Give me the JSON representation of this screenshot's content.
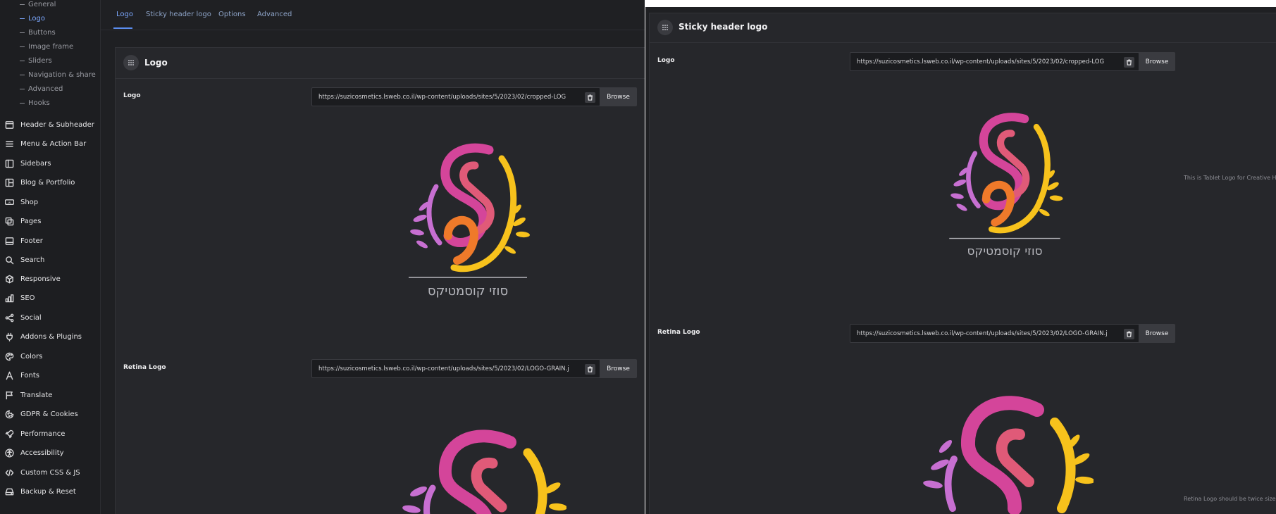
{
  "sidebar": {
    "sub_items": [
      "General",
      "Logo",
      "Buttons",
      "Image frame",
      "Sliders",
      "Navigation & share",
      "Advanced",
      "Hooks"
    ],
    "active_sub_item": "Logo",
    "items": [
      {
        "label": "Header & Subheader",
        "icon": "header-icon"
      },
      {
        "label": "Menu & Action Bar",
        "icon": "menu-icon"
      },
      {
        "label": "Sidebars",
        "icon": "sidebar-icon"
      },
      {
        "label": "Blog & Portfolio",
        "icon": "blog-icon"
      },
      {
        "label": "Shop",
        "icon": "woo-icon"
      },
      {
        "label": "Pages",
        "icon": "pages-icon"
      },
      {
        "label": "Footer",
        "icon": "footer-icon"
      },
      {
        "label": "Search",
        "icon": "search-icon"
      },
      {
        "label": "Responsive",
        "icon": "responsive-icon"
      },
      {
        "label": "SEO",
        "icon": "seo-icon"
      },
      {
        "label": "Social",
        "icon": "share-icon"
      },
      {
        "label": "Addons & Plugins",
        "icon": "plug-icon"
      },
      {
        "label": "Colors",
        "icon": "palette-icon"
      },
      {
        "label": "Fonts",
        "icon": "font-icon"
      },
      {
        "label": "Translate",
        "icon": "flag-icon"
      },
      {
        "label": "GDPR & Cookies",
        "icon": "cookie-icon"
      },
      {
        "label": "Performance",
        "icon": "rocket-icon"
      },
      {
        "label": "Accessibility",
        "icon": "accessibility-icon"
      },
      {
        "label": "Custom CSS & JS",
        "icon": "code-icon"
      },
      {
        "label": "Backup & Reset",
        "icon": "drive-icon"
      }
    ]
  },
  "tabs": {
    "items": [
      "Logo",
      "Sticky header logo",
      "Options",
      "Advanced"
    ],
    "active": "Logo"
  },
  "left_panel": {
    "title": "Logo",
    "logo_field": {
      "label": "Logo",
      "value": "https://suzicosmetics.lsweb.co.il/wp-content/uploads/sites/5/2023/02/cropped-LOG",
      "browse_label": "Browse"
    },
    "retina_field": {
      "label": "Retina Logo",
      "value": "https://suzicosmetics.lsweb.co.il/wp-content/uploads/sites/5/2023/02/LOGO-GRAIN.j",
      "browse_label": "Browse"
    },
    "logo_caption": "סוזי קוסמטיקס"
  },
  "right_panel": {
    "title": "Sticky header logo",
    "logo_field": {
      "label": "Logo",
      "value": "https://suzicosmetics.lsweb.co.il/wp-content/uploads/sites/5/2023/02/cropped-LOG",
      "browse_label": "Browse",
      "note": "This is Tablet Logo for Creative H"
    },
    "retina_field": {
      "label": "Retina Logo",
      "value": "https://suzicosmetics.lsweb.co.il/wp-content/uploads/sites/5/2023/02/LOGO-GRAIN.j",
      "browse_label": "Browse",
      "note": "Retina Logo should be twice size"
    },
    "logo_caption": "סוזי קוסמטיקס"
  },
  "colors": {
    "accent": "#7ca8ff",
    "background": "#1f2023",
    "panel": "#26272b",
    "logo_pink": "#d4459a",
    "logo_orange": "#ef7a2a",
    "logo_yellow": "#f7c21c",
    "logo_violet": "#c76fd1"
  }
}
